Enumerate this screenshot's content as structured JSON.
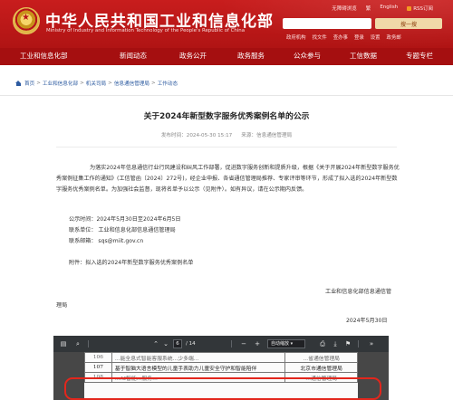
{
  "header": {
    "title": "中华人民共和国工业和信息化部",
    "subtitle": "Ministry of Industry and Information Technology of the People's Republic of China",
    "top_links": [
      "无障碍浏览",
      "繁",
      "English",
      "RSS订阅"
    ],
    "search_button": "搜一搜",
    "quick_links": [
      "政府机构",
      "找文件",
      "查办事",
      "登录",
      "设置",
      "政务邮"
    ]
  },
  "nav": {
    "items": [
      "工业和信息化部",
      "新闻动态",
      "政务公开",
      "政务服务",
      "公众参与",
      "工信数据",
      "专题专栏"
    ]
  },
  "breadcrumb": {
    "items": [
      "首页",
      "工业和信息化部",
      "机关司局",
      "信息通信管理局",
      "工作动态"
    ],
    "separator": ">"
  },
  "article": {
    "title": "关于2024年新型数字服务优秀案例名单的公示",
    "published": "发布时间：2024-05-30 15:17",
    "source": "来源：信息通信管理局",
    "paragraph1": "为落实2024年信息通信行业行风建设和纠风工作部署，促进数字服务创新和提质升级，根据《关于开展2024年新型数字服务优秀案例征集工作的通知》(工信管函〔2024〕272号)，经企业申报、各省通信管理局推荐、专家评审等环节，形成了拟入选的2024年新型数字服务优秀案例名单。为加强社会监督，现将名单予以公示（见附件）。如有异议，请在公示期内反馈。",
    "period": "公示时间：2024年5月30日至2024年6月5日",
    "contact_unit": "联系单位：  工业和信息化部信息通信管理局",
    "contact_email": "联系邮箱：  sqs@miit.gov.cn",
    "attachment": "附件：拟入选的2024年新型数字服务优秀案例名单",
    "sign_org_line1": "工业和信息化部信息通信管",
    "sign_org_line2": "理局",
    "sign_date": "2024年5月30日"
  },
  "pdf_viewer": {
    "page_current": "6",
    "page_total": "/ 14",
    "zoom": "自动缩放",
    "toolbar_icons": [
      "sidebar-toggle-icon",
      "search-icon",
      "previous-page-icon",
      "next-page-icon",
      "zoom-out-icon",
      "zoom-in-icon",
      "print-icon",
      "download-icon",
      "bookmark-icon",
      "tools-icon"
    ],
    "rows": [
      {
        "no": "106",
        "name": "…能全息式智能客服系统…少多端…",
        "unit": "…省通信管理局"
      },
      {
        "no": "107",
        "name": "基于智脑大语言模型的儿童手表助力儿童安全守护和智能陪伴",
        "unit": "北京市通信管理局"
      },
      {
        "no": "108",
        "name": "…AI智能…服务…",
        "unit": "…通信管理局"
      }
    ]
  },
  "colors": {
    "header_red": "#c81d1d",
    "nav_red": "#a50f10",
    "highlight_red": "#e2261c",
    "link_blue": "#2c5aa0"
  }
}
